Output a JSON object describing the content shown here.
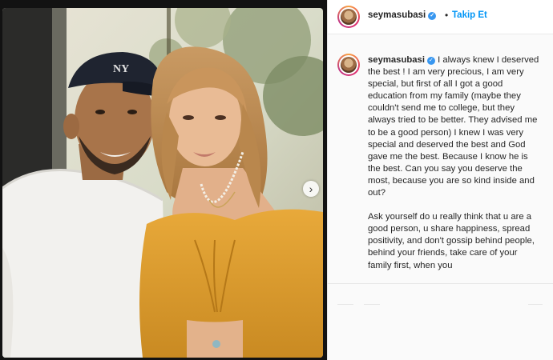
{
  "post": {
    "username": "seymasubasi",
    "follow_label": "Takip Et",
    "separator": "•",
    "verified_glyph": "✓",
    "caption_para1": "I always knew I deserved the best ! I am very precious, I am very special, but first of all I got a good education from my family (maybe they couldn't send me to college, but they always tried to be better. They advised me to be a good person) I knew I was very special and deserved the best and God gave me the best. Because I know he is the best. Can you say you deserve the most, because you are so kind inside and out?",
    "caption_para2": "Ask yourself do u really think that u are a good person, u share happiness, spread positivity, and don't gossip behind people, behind your friends, take care of your family first, when you"
  },
  "carousel": {
    "next_glyph": "›"
  },
  "icons": {
    "verified": "verified-badge-icon",
    "next": "chevron-right-icon"
  },
  "colors": {
    "link_blue": "#0095f6",
    "verified_blue": "#3897f0",
    "text": "#262626"
  }
}
